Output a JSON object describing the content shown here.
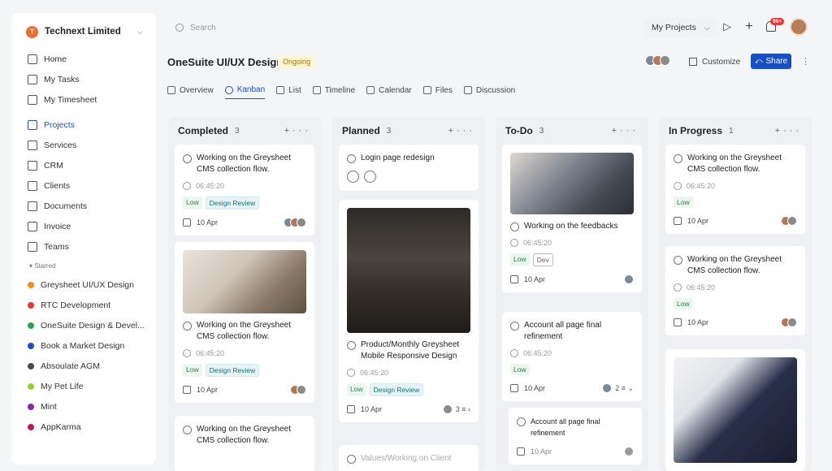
{
  "org": {
    "name": "Technext Limited",
    "logo_letter": "T"
  },
  "nav": [
    {
      "label": "Home",
      "icon": "home-icon"
    },
    {
      "label": "My Tasks",
      "icon": "tasks-icon"
    },
    {
      "label": "My Timesheet",
      "icon": "timesheet-icon"
    },
    {
      "label": "Projects",
      "icon": "projects-icon",
      "active": true
    },
    {
      "label": "Services",
      "icon": "services-icon"
    },
    {
      "label": "CRM",
      "icon": "crm-icon"
    },
    {
      "label": "Clients",
      "icon": "clients-icon"
    },
    {
      "label": "Documents",
      "icon": "documents-icon"
    },
    {
      "label": "Invoice",
      "icon": "invoice-icon"
    },
    {
      "label": "Teams",
      "icon": "teams-icon"
    }
  ],
  "starred": {
    "label": "Starred",
    "items": [
      {
        "label": "Greysheet UI/UX Design",
        "color": "#f28c28"
      },
      {
        "label": "RTC Development",
        "color": "#e53935"
      },
      {
        "label": "OneSuite Design & Devel...",
        "color": "#2e9e5b"
      },
      {
        "label": "Book a Market Design",
        "color": "#1a4fc4"
      },
      {
        "label": "Absoulate AGM",
        "color": "#4a4a4a"
      },
      {
        "label": "My Pet Life",
        "color": "#9ccc2c"
      },
      {
        "label": "Mint",
        "color": "#8e24aa"
      },
      {
        "label": "AppKarma",
        "color": "#c2185b"
      }
    ]
  },
  "topbar": {
    "search_placeholder": "Search",
    "my_projects": "My Projects",
    "notif_badge": "99+"
  },
  "project": {
    "title": "OneSuite UI/UX Design",
    "status": "Ongoing",
    "customize": "Customize",
    "share": "Share"
  },
  "tabs": [
    {
      "label": "Overview"
    },
    {
      "label": "Kanban",
      "active": true
    },
    {
      "label": "List"
    },
    {
      "label": "Timeline"
    },
    {
      "label": "Calendar"
    },
    {
      "label": "Files"
    },
    {
      "label": "Discussion"
    }
  ],
  "columns": [
    {
      "title": "Completed",
      "count": "3",
      "cards": [
        {
          "title": "Working on the Greysheet CMS collection flow.",
          "time": "06:45:20",
          "tags": [
            "Low",
            "Design Review"
          ],
          "date": "10 Apr"
        },
        {
          "title": "Working on the Greysheet CMS collection flow.",
          "time": "06:45:20",
          "tags": [
            "Low",
            "Design Review"
          ],
          "date": "10 Apr"
        },
        {
          "title": "Working on the Greysheet CMS collection flow."
        }
      ]
    },
    {
      "title": "Planned",
      "count": "3",
      "cards": [
        {
          "title": "Login page redesign"
        },
        {
          "title": "Product/Monthly Greysheet Mobile Responsive Design",
          "time": "06:45:20",
          "tags": [
            "Low",
            "Design Review"
          ],
          "date": "10 Apr",
          "subtasks": "3"
        },
        {
          "title": "Values/Working on Client"
        }
      ]
    },
    {
      "title": "To-Do",
      "count": "3",
      "cards": [
        {
          "title": "Working on the feedbacks",
          "time": "06:45:20",
          "tags": [
            "Low",
            "Dev"
          ],
          "date": "10 Apr"
        },
        {
          "title": "Account all page final refinement",
          "time": "06:45:20",
          "tags": [
            "Low"
          ],
          "date": "10 Apr",
          "subtasks": "2"
        },
        {
          "title": "Account all page final refinement",
          "date": "10 Apr"
        }
      ]
    },
    {
      "title": "In Progress",
      "count": "1",
      "cards": [
        {
          "title": "Working on the Greysheet CMS collection flow.",
          "time": "06:45:20",
          "tags": [
            "Low"
          ],
          "date": "10 Apr"
        },
        {
          "title": "Working on the Greysheet CMS collection flow.",
          "time": "06:45:20",
          "tags": [
            "Low"
          ],
          "date": "10 Apr"
        }
      ]
    }
  ],
  "colors": {
    "accent": "#1a4fc4",
    "status_bg": "#fdf5d7",
    "status_fg": "#a07a00",
    "tag_low": "#2e7d4f"
  }
}
